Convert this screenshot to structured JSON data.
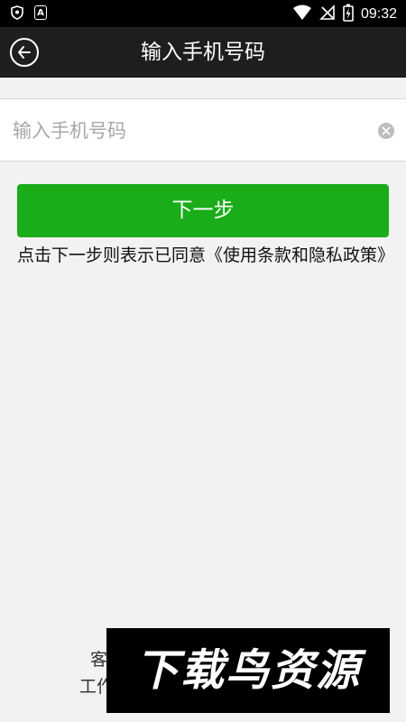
{
  "status_bar": {
    "left_icons": [
      "shield-icon",
      "a-icon"
    ],
    "a_letter": "A",
    "right_icons": [
      "wifi-icon",
      "no-signal-icon",
      "battery-charging-icon"
    ],
    "time": "09:32"
  },
  "header": {
    "back_icon": "back-arrow-circle-icon",
    "title": "输入手机号码"
  },
  "phone_input": {
    "value": "",
    "placeholder": "输入手机号码",
    "clear_icon": "clear-icon"
  },
  "next_button": {
    "label": "下一步",
    "color": "#1aad19"
  },
  "agreement_text": "点击下一步则表示已同意《使用条款和隐私政策》",
  "footer": {
    "line1": "客",
    "line2": "工作"
  },
  "watermark": {
    "text": "下载鸟资源"
  }
}
